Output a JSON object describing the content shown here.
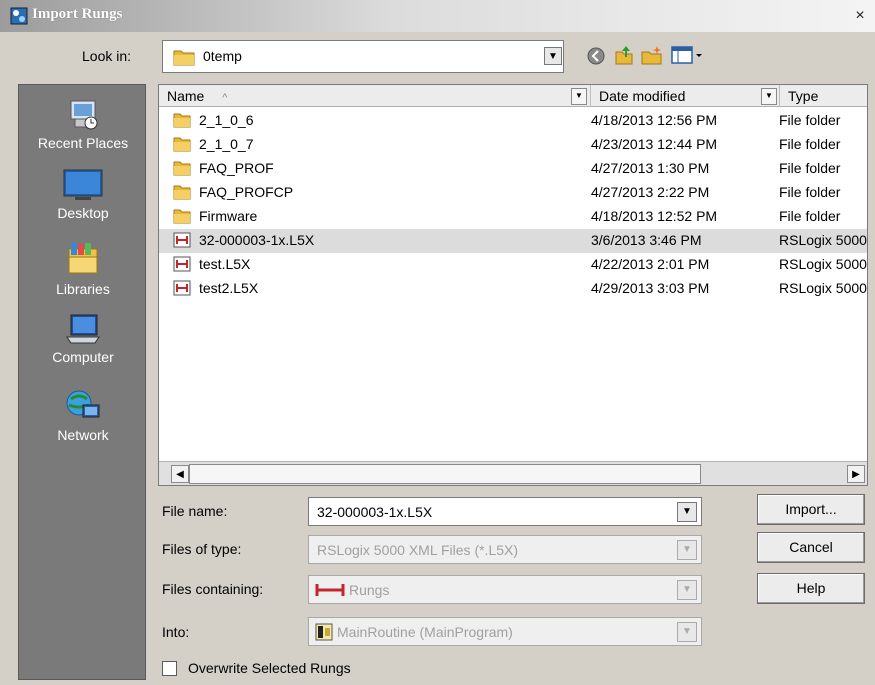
{
  "window": {
    "title": "Import Rungs",
    "close_glyph": "×"
  },
  "lookin": {
    "label": "Look in:",
    "value": "0temp",
    "dropdown_glyph": "▼"
  },
  "places": [
    {
      "label": "Recent Places",
      "icon": "recent-places-icon"
    },
    {
      "label": "Desktop",
      "icon": "desktop-icon"
    },
    {
      "label": "Libraries",
      "icon": "libraries-icon"
    },
    {
      "label": "Computer",
      "icon": "computer-icon"
    },
    {
      "label": "Network",
      "icon": "network-icon"
    }
  ],
  "list": {
    "columns": [
      {
        "label": "Name",
        "sort_glyph": "^"
      },
      {
        "label": "Date modified"
      },
      {
        "label": "Type"
      }
    ],
    "dropdown_glyph": "▼",
    "rows": [
      {
        "name": "2_1_0_6",
        "date": "4/18/2013 12:56 PM",
        "type": "File folder",
        "icon": "folder-icon",
        "selected": false
      },
      {
        "name": "2_1_0_7",
        "date": "4/23/2013 12:44 PM",
        "type": "File folder",
        "icon": "folder-icon",
        "selected": false
      },
      {
        "name": "FAQ_PROF",
        "date": "4/27/2013 1:30 PM",
        "type": "File folder",
        "icon": "folder-icon",
        "selected": false
      },
      {
        "name": "FAQ_PROFCP",
        "date": "4/27/2013 2:22 PM",
        "type": "File folder",
        "icon": "folder-icon",
        "selected": false
      },
      {
        "name": "Firmware",
        "date": "4/18/2013 12:52 PM",
        "type": "File folder",
        "icon": "folder-icon",
        "selected": false
      },
      {
        "name": "32-000003-1x.L5X",
        "date": "3/6/2013 3:46 PM",
        "type": "RSLogix 5000",
        "icon": "rung-file-icon",
        "selected": true
      },
      {
        "name": "test.L5X",
        "date": "4/22/2013 2:01 PM",
        "type": "RSLogix 5000",
        "icon": "rung-file-icon",
        "selected": false
      },
      {
        "name": "test2.L5X",
        "date": "4/29/2013 3:03 PM",
        "type": "RSLogix 5000",
        "icon": "rung-file-icon",
        "selected": false
      }
    ],
    "scroll_left_glyph": "◀",
    "scroll_right_glyph": "▶"
  },
  "form": {
    "file_name": {
      "label": "File name:",
      "value": "32-000003-1x.L5X"
    },
    "file_type": {
      "label": "Files of type:",
      "value": "RSLogix 5000 XML Files (*.L5X)"
    },
    "containing": {
      "label": "Files containing:",
      "value": "Rungs"
    },
    "into": {
      "label": "Into:",
      "value": "MainRoutine (MainProgram)"
    },
    "overwrite": {
      "label": "Overwrite Selected Rungs",
      "checked": false
    }
  },
  "buttons": {
    "import": "Import...",
    "cancel": "Cancel",
    "help": "Help"
  },
  "colors": {
    "places_bg": "#7a7a7a",
    "selected_row": "#dcdcdc",
    "rung_red": "#c0282d",
    "folder_yellow": "#e8b83a"
  }
}
